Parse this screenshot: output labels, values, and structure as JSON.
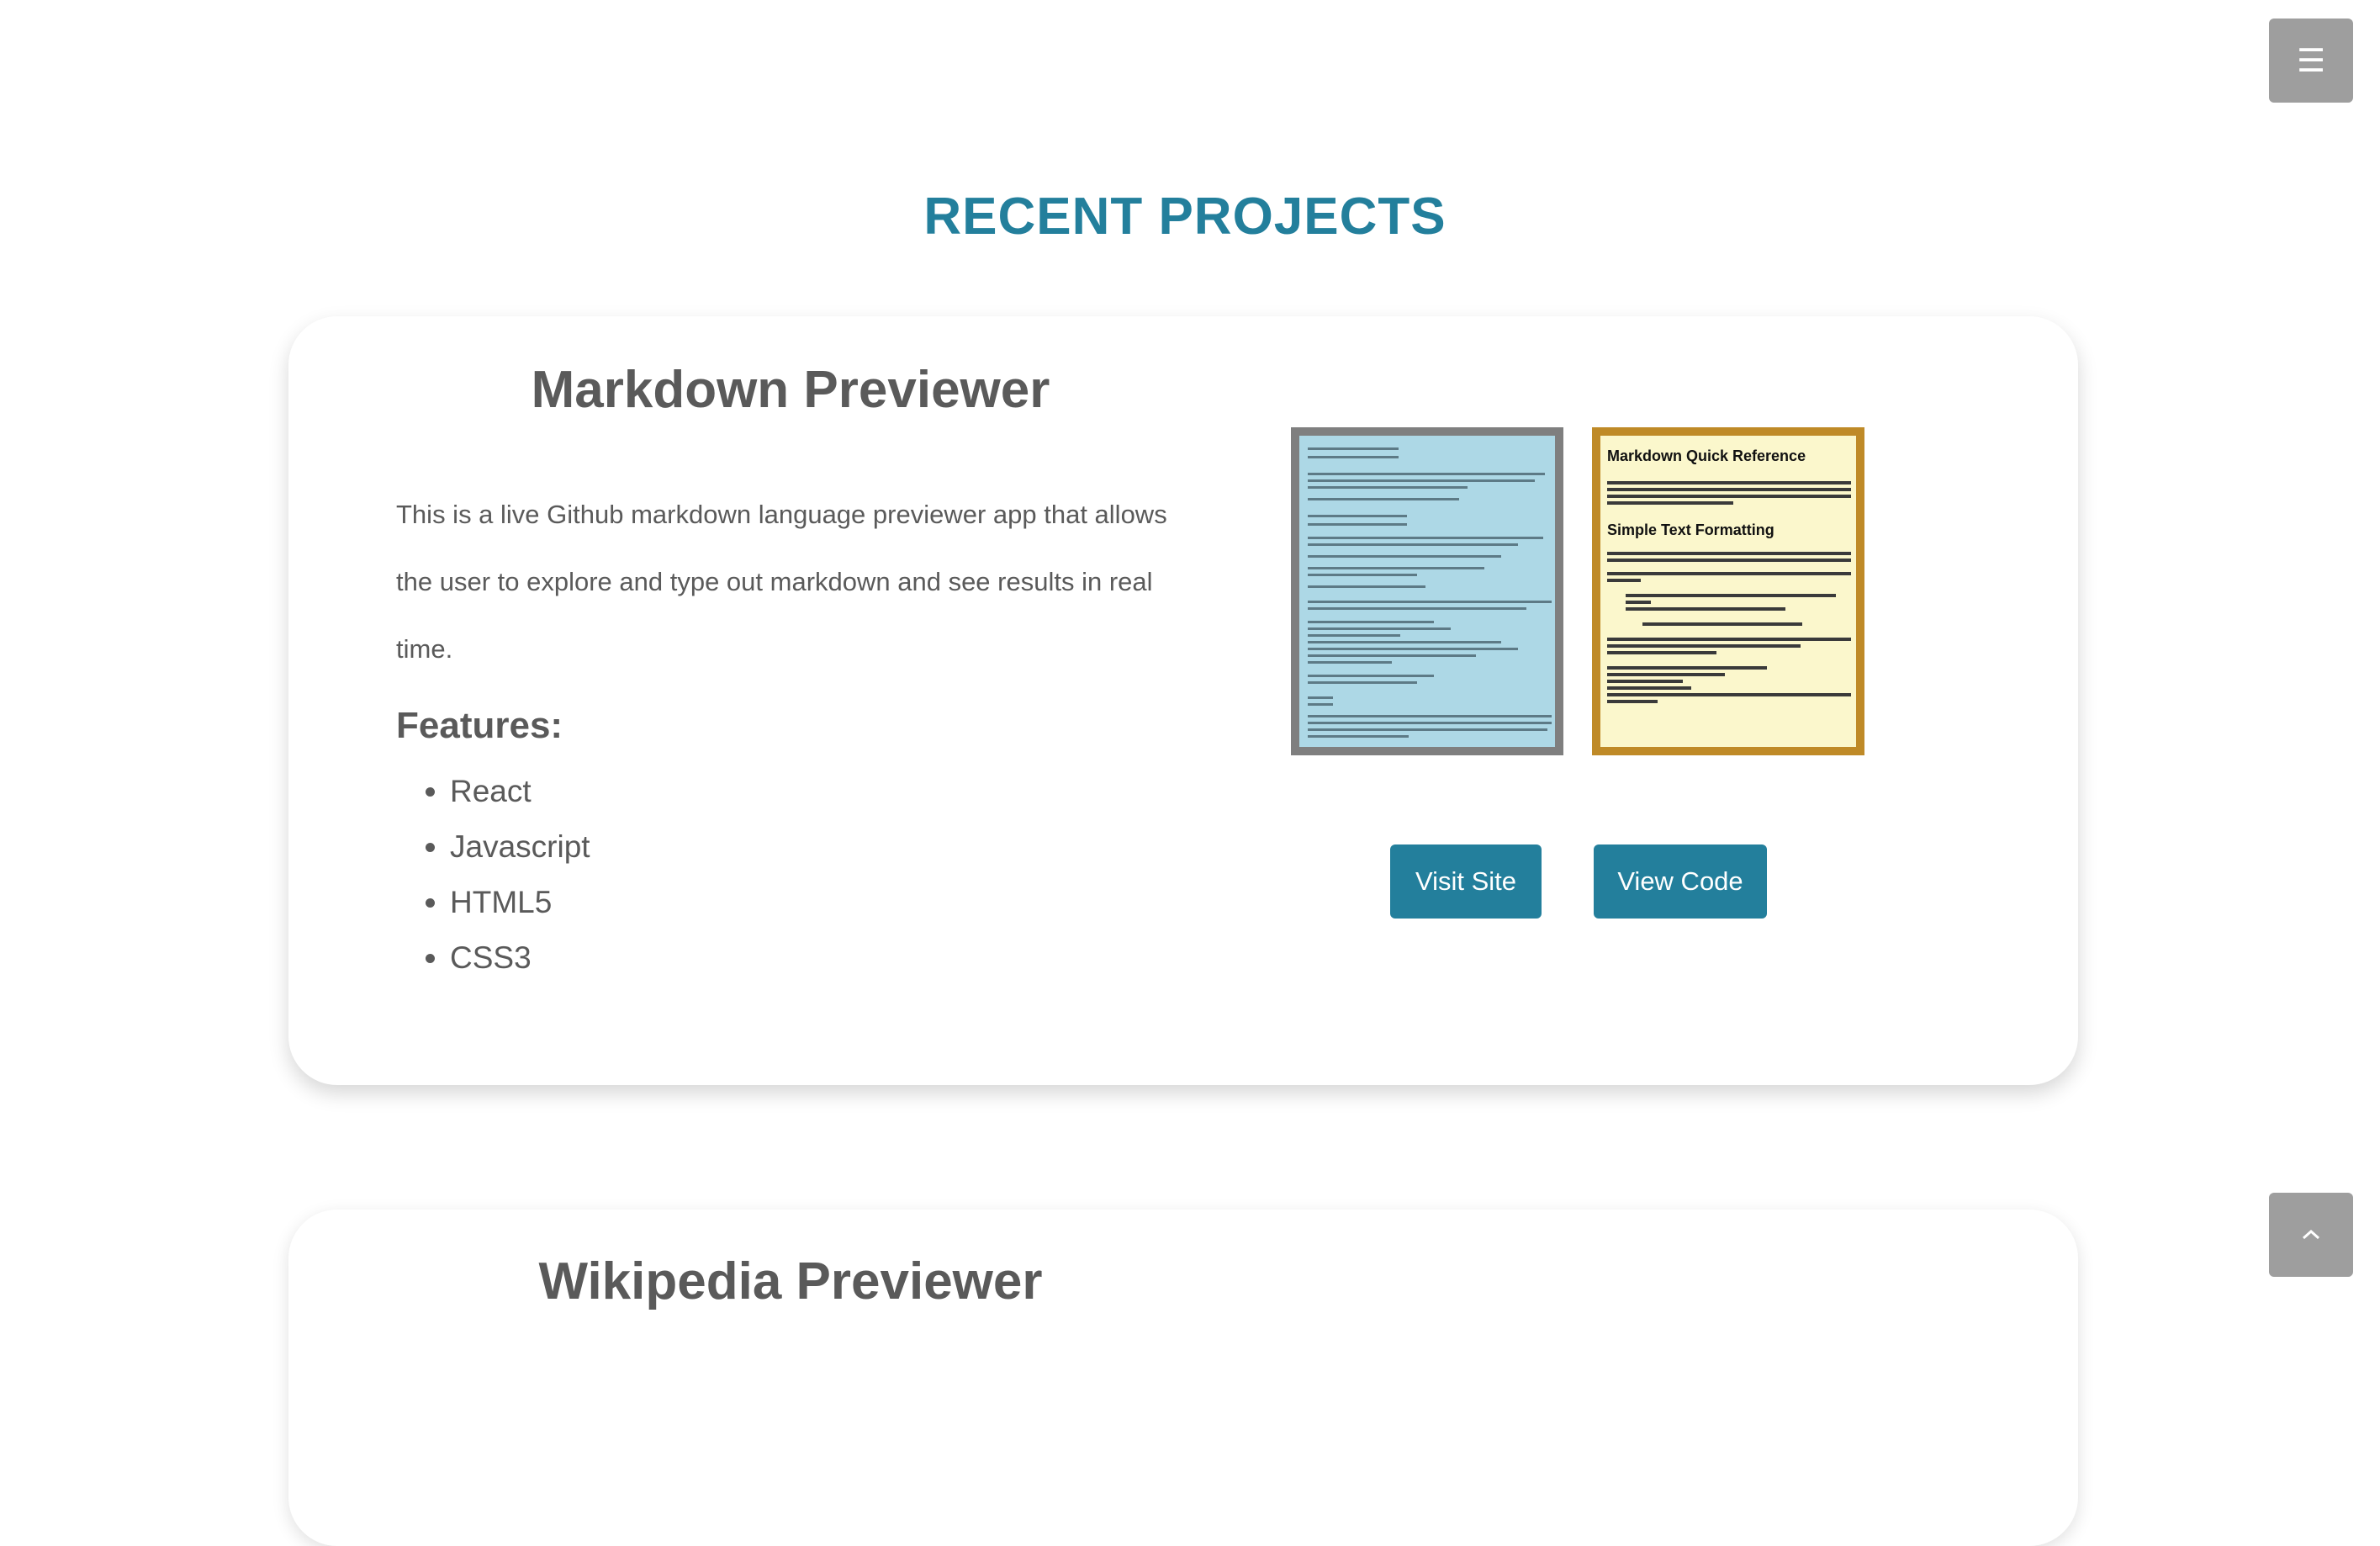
{
  "nav": {
    "menu_icon": "hamburger-menu-icon",
    "menu_glyph": "☰"
  },
  "section": {
    "title": "RECENT PROJECTS"
  },
  "projects": [
    {
      "title": "Markdown Previewer",
      "description": "This is a live Github markdown language previewer app that allows the user to explore and type out markdown and see results in real time.",
      "features_heading": "Features:",
      "features": [
        "React",
        "Javascript",
        "HTML5",
        "CSS3"
      ],
      "visit_label": "Visit Site",
      "code_label": "View Code",
      "thumbnails": {
        "themed_heading": "Markdown Quick Reference",
        "themed_subheading": "Simple Text Formatting"
      }
    },
    {
      "title": "Wikipedia Previewer"
    }
  ],
  "scroll_top": {
    "icon": "chevron-up-icon"
  },
  "colors": {
    "accent": "#237f9c",
    "menu_button": "#9e9e9e",
    "thumb_blue": "#add8e6",
    "thumb_blue_border": "#7f7f7f",
    "thumb_cream": "#fbf7cc",
    "thumb_gold_border": "#bf8a27"
  }
}
